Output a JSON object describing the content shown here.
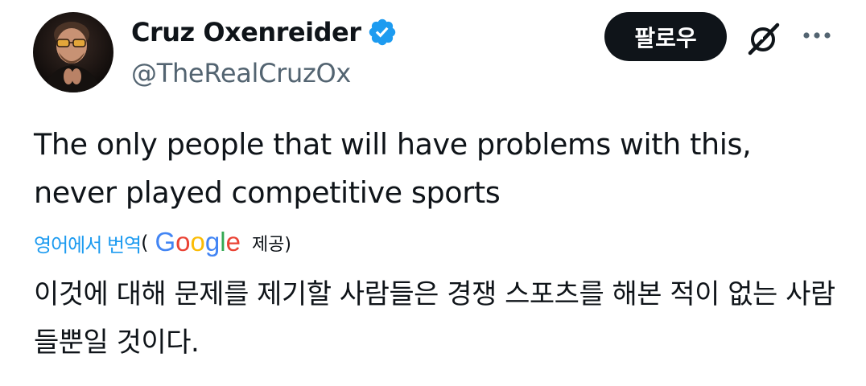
{
  "author": {
    "display_name": "Cruz Oxenreider",
    "handle": "@TheRealCruzOx",
    "verified_icon": "verified-badge-icon"
  },
  "actions": {
    "follow_label": "팔로우",
    "grok_icon": "grok-icon",
    "more_icon": "more-icon"
  },
  "tweet": {
    "text": "The only people that will have problems with this,\nnever played competitive sports"
  },
  "translation": {
    "link_label": "영어에서 번역",
    "open_paren": "(",
    "provider_letters": [
      "G",
      "o",
      "o",
      "g",
      "l",
      "e"
    ],
    "provided_label": "제공)",
    "translated_text": "이것에 대해 문제를 제기할 사람들은 경쟁 스포츠를 해본 적이 없는 사람들뿐일 것이다."
  },
  "colors": {
    "accent": "#1d9bf0",
    "text_primary": "#0f1419",
    "text_secondary": "#536471",
    "google_blue": "#4285f4",
    "google_red": "#ea4335",
    "google_yellow": "#fbbc05",
    "google_green": "#34a853"
  }
}
